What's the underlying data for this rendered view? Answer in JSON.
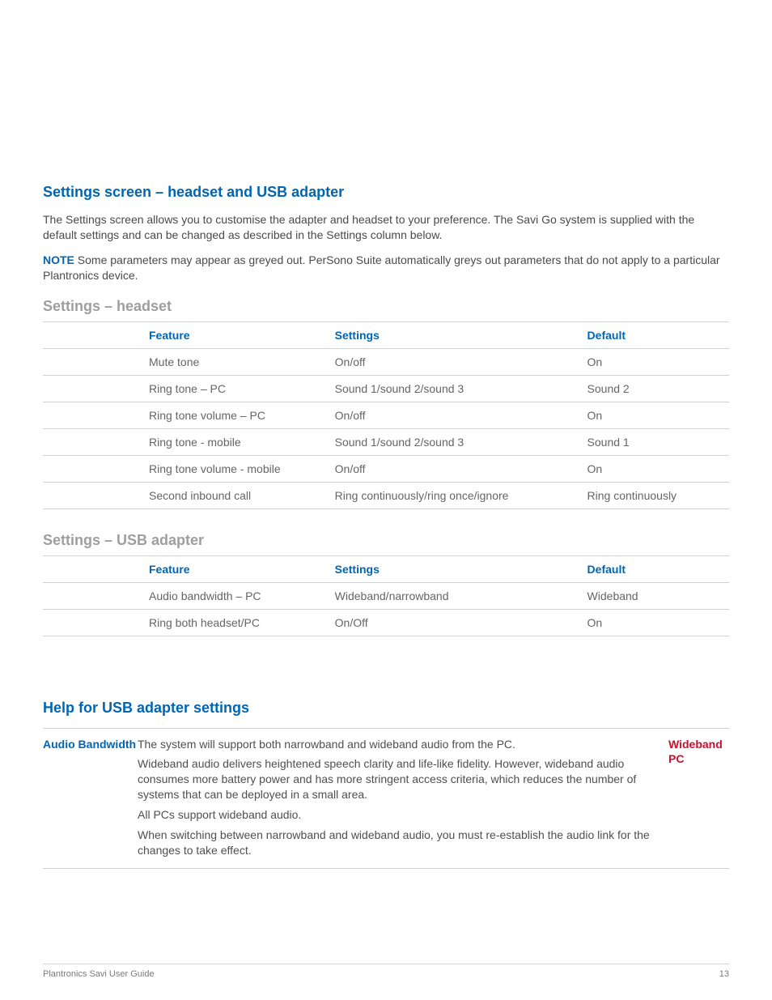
{
  "section1": {
    "title": "Settings screen – headset and USB adapter",
    "para1": "The Settings screen allows you to customise the adapter and headset to your preference. The Savi Go system is supplied with the default settings and can be changed as described in the Settings column below.",
    "note_label": "NOTE",
    "note_body": " Some parameters may appear as greyed out. PerSono Suite automatically greys out parameters that do not apply to a particular Plantronics device."
  },
  "headset": {
    "header": "Settings – headset",
    "th_feature": "Feature",
    "th_settings": "Settings",
    "th_default": "Default",
    "rows": [
      {
        "feature": "Mute tone",
        "settings": "On/off",
        "default": "On"
      },
      {
        "feature": "Ring tone – PC",
        "settings": "Sound 1/sound 2/sound 3",
        "default": "Sound 2"
      },
      {
        "feature": "Ring tone volume – PC",
        "settings": "On/off",
        "default": "On"
      },
      {
        "feature": "Ring tone - mobile",
        "settings": "Sound 1/sound 2/sound 3",
        "default": "Sound 1"
      },
      {
        "feature": "Ring tone volume - mobile",
        "settings": "On/off",
        "default": "On"
      },
      {
        "feature": "Second inbound call",
        "settings": "Ring continuously/ring once/ignore",
        "default": "Ring continuously"
      }
    ]
  },
  "usb": {
    "header": "Settings – USB adapter",
    "th_feature": "Feature",
    "th_settings": "Settings",
    "th_default": "Default",
    "rows": [
      {
        "feature": "Audio bandwidth – PC",
        "settings": "Wideband/narrowband",
        "default": "Wideband"
      },
      {
        "feature": "Ring both headset/PC",
        "settings": "On/Off",
        "default": "On"
      }
    ]
  },
  "help": {
    "title": "Help for USB adapter settings",
    "left": "Audio Bandwidth",
    "right": "Wideband PC",
    "p1": "The system will support both narrowband and wideband audio from the PC.",
    "p2": "Wideband audio delivers heightened speech clarity and life-like fidelity. However, wideband audio consumes more battery power and has more stringent access criteria, which reduces the number of systems that can be deployed in a small area.",
    "p3": "All PCs support wideband audio.",
    "p4": "When switching between narrowband and wideband audio, you must re-establish the audio link for the changes to take effect."
  },
  "footer": {
    "left": "Plantronics Savi User Guide",
    "right": "13"
  }
}
